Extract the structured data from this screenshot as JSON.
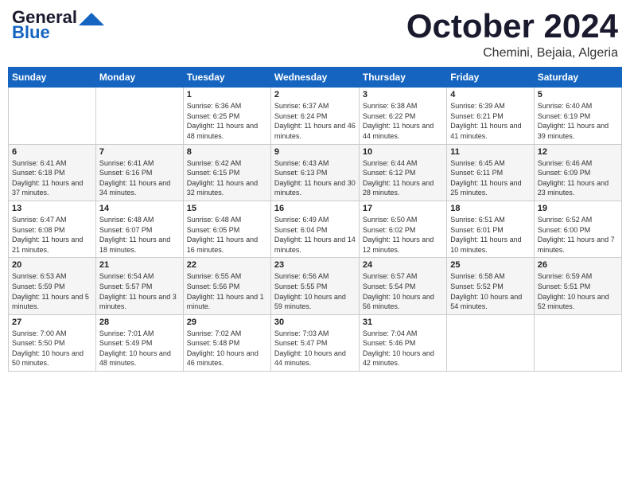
{
  "header": {
    "logo_line1": "General",
    "logo_line2": "Blue",
    "month": "October 2024",
    "location": "Chemini, Bejaia, Algeria"
  },
  "days_of_week": [
    "Sunday",
    "Monday",
    "Tuesday",
    "Wednesday",
    "Thursday",
    "Friday",
    "Saturday"
  ],
  "weeks": [
    [
      {
        "day": "",
        "info": ""
      },
      {
        "day": "",
        "info": ""
      },
      {
        "day": "1",
        "info": "Sunrise: 6:36 AM\nSunset: 6:25 PM\nDaylight: 11 hours and 48 minutes."
      },
      {
        "day": "2",
        "info": "Sunrise: 6:37 AM\nSunset: 6:24 PM\nDaylight: 11 hours and 46 minutes."
      },
      {
        "day": "3",
        "info": "Sunrise: 6:38 AM\nSunset: 6:22 PM\nDaylight: 11 hours and 44 minutes."
      },
      {
        "day": "4",
        "info": "Sunrise: 6:39 AM\nSunset: 6:21 PM\nDaylight: 11 hours and 41 minutes."
      },
      {
        "day": "5",
        "info": "Sunrise: 6:40 AM\nSunset: 6:19 PM\nDaylight: 11 hours and 39 minutes."
      }
    ],
    [
      {
        "day": "6",
        "info": "Sunrise: 6:41 AM\nSunset: 6:18 PM\nDaylight: 11 hours and 37 minutes."
      },
      {
        "day": "7",
        "info": "Sunrise: 6:41 AM\nSunset: 6:16 PM\nDaylight: 11 hours and 34 minutes."
      },
      {
        "day": "8",
        "info": "Sunrise: 6:42 AM\nSunset: 6:15 PM\nDaylight: 11 hours and 32 minutes."
      },
      {
        "day": "9",
        "info": "Sunrise: 6:43 AM\nSunset: 6:13 PM\nDaylight: 11 hours and 30 minutes."
      },
      {
        "day": "10",
        "info": "Sunrise: 6:44 AM\nSunset: 6:12 PM\nDaylight: 11 hours and 28 minutes."
      },
      {
        "day": "11",
        "info": "Sunrise: 6:45 AM\nSunset: 6:11 PM\nDaylight: 11 hours and 25 minutes."
      },
      {
        "day": "12",
        "info": "Sunrise: 6:46 AM\nSunset: 6:09 PM\nDaylight: 11 hours and 23 minutes."
      }
    ],
    [
      {
        "day": "13",
        "info": "Sunrise: 6:47 AM\nSunset: 6:08 PM\nDaylight: 11 hours and 21 minutes."
      },
      {
        "day": "14",
        "info": "Sunrise: 6:48 AM\nSunset: 6:07 PM\nDaylight: 11 hours and 18 minutes."
      },
      {
        "day": "15",
        "info": "Sunrise: 6:48 AM\nSunset: 6:05 PM\nDaylight: 11 hours and 16 minutes."
      },
      {
        "day": "16",
        "info": "Sunrise: 6:49 AM\nSunset: 6:04 PM\nDaylight: 11 hours and 14 minutes."
      },
      {
        "day": "17",
        "info": "Sunrise: 6:50 AM\nSunset: 6:02 PM\nDaylight: 11 hours and 12 minutes."
      },
      {
        "day": "18",
        "info": "Sunrise: 6:51 AM\nSunset: 6:01 PM\nDaylight: 11 hours and 10 minutes."
      },
      {
        "day": "19",
        "info": "Sunrise: 6:52 AM\nSunset: 6:00 PM\nDaylight: 11 hours and 7 minutes."
      }
    ],
    [
      {
        "day": "20",
        "info": "Sunrise: 6:53 AM\nSunset: 5:59 PM\nDaylight: 11 hours and 5 minutes."
      },
      {
        "day": "21",
        "info": "Sunrise: 6:54 AM\nSunset: 5:57 PM\nDaylight: 11 hours and 3 minutes."
      },
      {
        "day": "22",
        "info": "Sunrise: 6:55 AM\nSunset: 5:56 PM\nDaylight: 11 hours and 1 minute."
      },
      {
        "day": "23",
        "info": "Sunrise: 6:56 AM\nSunset: 5:55 PM\nDaylight: 10 hours and 59 minutes."
      },
      {
        "day": "24",
        "info": "Sunrise: 6:57 AM\nSunset: 5:54 PM\nDaylight: 10 hours and 56 minutes."
      },
      {
        "day": "25",
        "info": "Sunrise: 6:58 AM\nSunset: 5:52 PM\nDaylight: 10 hours and 54 minutes."
      },
      {
        "day": "26",
        "info": "Sunrise: 6:59 AM\nSunset: 5:51 PM\nDaylight: 10 hours and 52 minutes."
      }
    ],
    [
      {
        "day": "27",
        "info": "Sunrise: 7:00 AM\nSunset: 5:50 PM\nDaylight: 10 hours and 50 minutes."
      },
      {
        "day": "28",
        "info": "Sunrise: 7:01 AM\nSunset: 5:49 PM\nDaylight: 10 hours and 48 minutes."
      },
      {
        "day": "29",
        "info": "Sunrise: 7:02 AM\nSunset: 5:48 PM\nDaylight: 10 hours and 46 minutes."
      },
      {
        "day": "30",
        "info": "Sunrise: 7:03 AM\nSunset: 5:47 PM\nDaylight: 10 hours and 44 minutes."
      },
      {
        "day": "31",
        "info": "Sunrise: 7:04 AM\nSunset: 5:46 PM\nDaylight: 10 hours and 42 minutes."
      },
      {
        "day": "",
        "info": ""
      },
      {
        "day": "",
        "info": ""
      }
    ]
  ]
}
